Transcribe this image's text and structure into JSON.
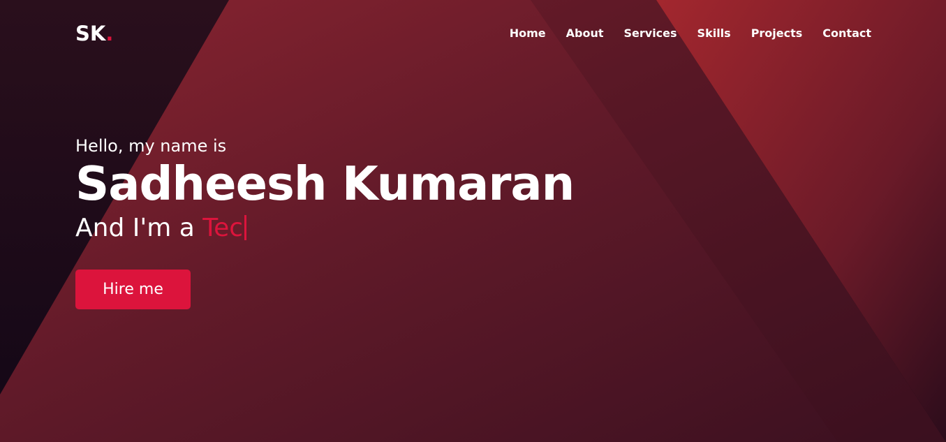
{
  "brand": {
    "logo_text": "SK",
    "logo_dot": "."
  },
  "nav": {
    "items": [
      {
        "label": "Home"
      },
      {
        "label": "About"
      },
      {
        "label": "Services"
      },
      {
        "label": "Skills"
      },
      {
        "label": "Projects"
      },
      {
        "label": "Contact"
      }
    ]
  },
  "hero": {
    "greeting": "Hello, my name is",
    "name": "Sadheesh Kumaran",
    "intro_prefix": "And I'm a ",
    "typed_text": "Tec",
    "cta_label": "Hire me"
  },
  "colors": {
    "accent": "#dc143c",
    "text": "#ffffff",
    "background": "#2c0f1c"
  }
}
